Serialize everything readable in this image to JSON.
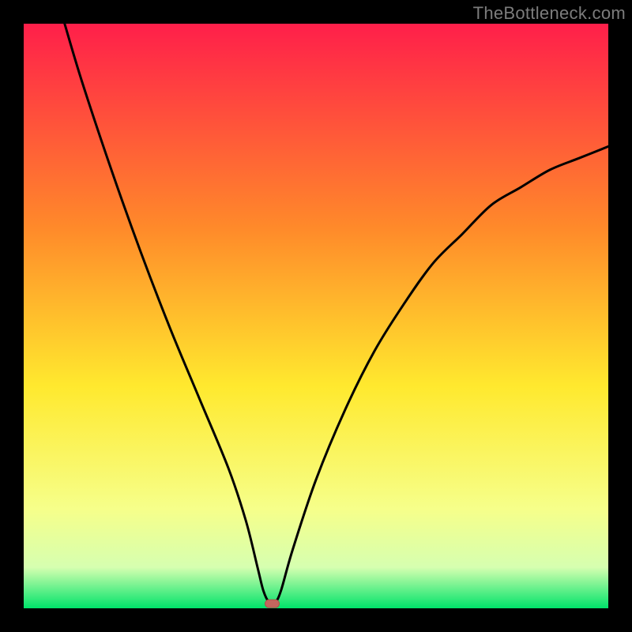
{
  "watermark": "TheBottleneck.com",
  "colors": {
    "frame": "#000000",
    "gradient_top": "#ff1f4a",
    "gradient_mid1": "#ff8a2a",
    "gradient_mid2": "#ffe92e",
    "gradient_mid3": "#f6ff8a",
    "gradient_band_light": "#d6ffb0",
    "gradient_bottom": "#00e36a",
    "curve": "#000000",
    "marker_fill": "#c4665e",
    "marker_stroke": "#b05048"
  },
  "chart_data": {
    "type": "line",
    "title": "",
    "xlabel": "",
    "ylabel": "",
    "xlim": [
      0,
      100
    ],
    "ylim": [
      0,
      100
    ],
    "series": [
      {
        "name": "bottleneck-curve",
        "x": [
          7,
          10,
          15,
          20,
          25,
          30,
          35,
          38,
          40,
          41,
          42,
          43,
          44,
          46,
          50,
          55,
          60,
          65,
          70,
          75,
          80,
          85,
          90,
          95,
          100
        ],
        "values": [
          100,
          90,
          75,
          61,
          48,
          36,
          24,
          15,
          7,
          3,
          1,
          1,
          3,
          10,
          22,
          34,
          44,
          52,
          59,
          64,
          69,
          72,
          75,
          77,
          79
        ]
      }
    ],
    "marker": {
      "x": 42.5,
      "y": 0.8,
      "label": "optimal-point"
    },
    "annotations": []
  }
}
